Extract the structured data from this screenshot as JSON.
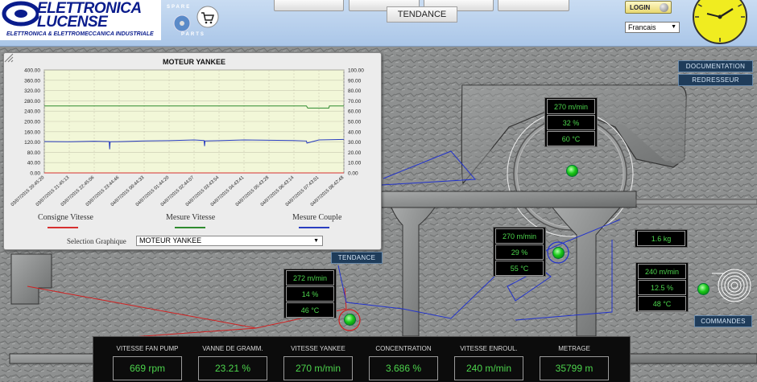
{
  "header": {
    "logo_line1": "ELETTRONICA",
    "logo_line2": "LUCENSE",
    "logo_sub": "ELETTRONICA & ELETTROMECCANICA INDUSTRIALE",
    "spare_text": "SPARE",
    "parts_text": "PARTS",
    "tendance_button": "TENDANCE",
    "login_label": "LOGIN",
    "language": "Francais"
  },
  "chart_window": {
    "selection_label": "Selection Graphique",
    "selection_value": "MOTEUR YANKEE",
    "legend": [
      {
        "label": "Consigne Vitesse",
        "color": "#d63030"
      },
      {
        "label": "Mesure Vitesse",
        "color": "#2e8b2e"
      },
      {
        "label": "Mesure Couple",
        "color": "#2a3ec0"
      }
    ]
  },
  "chart_data": {
    "type": "line",
    "title": "MOTEUR YANKEE",
    "y_left": {
      "ylim": [
        0,
        400
      ],
      "ticks": [
        "400.00",
        "360.00",
        "320.00",
        "280.00",
        "240.00",
        "200.00",
        "160.00",
        "120.00",
        "80.00",
        "40.00",
        "0.00"
      ]
    },
    "y_right": {
      "ylim": [
        0,
        100
      ],
      "ticks": [
        "100.00",
        "90.00",
        "80.00",
        "70.00",
        "60.00",
        "50.00",
        "40.00",
        "30.00",
        "20.00",
        "10.00",
        "0.00"
      ]
    },
    "x_ticks": [
      "03/07/2015 20:45:20",
      "03/07/2015 21:45:13",
      "03/07/2015 22:45:06",
      "03/07/2015 23:44:46",
      "04/07/2015 00:44:33",
      "04/07/2015 01:44:20",
      "04/07/2015 02:44:07",
      "04/07/2015 03:43:54",
      "04/07/2015 04:43:41",
      "04/07/2015 05:43:28",
      "04/07/2015 06:43:14",
      "04/07/2015 07:43:01",
      "04/07/2015 08:42:48"
    ],
    "grid": true,
    "series": [
      {
        "name": "Mesure Vitesse",
        "color": "#2e8b2e",
        "axis": "right",
        "x": [
          0,
          10.5,
          10.55,
          11.4,
          11.42,
          12
        ],
        "y": [
          65,
          65,
          63,
          63,
          65,
          65
        ]
      },
      {
        "name": "Mesure Couple",
        "color": "#2a3ec0",
        "axis": "right",
        "x": [
          0,
          1,
          2,
          2.6,
          2.62,
          2.64,
          3,
          4,
          5,
          6,
          6.4,
          6.42,
          6.44,
          7,
          8,
          9,
          10,
          10.5,
          10.52,
          11,
          12
        ],
        "y": [
          30.5,
          30.2,
          30.8,
          30.5,
          23,
          30.3,
          30.4,
          31,
          31.3,
          32,
          31.5,
          26,
          31,
          31.3,
          32,
          31.7,
          31.5,
          31,
          29,
          32,
          32.5
        ]
      },
      {
        "name": "Consigne Vitesse",
        "color": "#d63030",
        "axis": "right",
        "x": [
          0,
          12
        ],
        "y": [
          0,
          0
        ]
      }
    ]
  },
  "overlays": {
    "tendance_button": "TENDANCE",
    "documentation_button": "DOCUMENTATION",
    "redresseur_button": "REDRESSEUR",
    "commandes_button": "COMMANDES",
    "yankee_readouts": [
      "270 m/min",
      "32 %",
      "60 °C"
    ],
    "middle_readouts": [
      "270 m/min",
      "29 %",
      "55 °C"
    ],
    "left_readouts": [
      "272 m/min",
      "14 %",
      "46 °C"
    ],
    "weight_readout": "1.6 kg",
    "reel_readouts": [
      "240 m/min",
      "12.5 %",
      "48 °C"
    ]
  },
  "bottom_panel": [
    {
      "label": "VITESSE FAN PUMP",
      "value": "669 rpm"
    },
    {
      "label": "VANNE DE GRAMM.",
      "value": "23.21 %"
    },
    {
      "label": "VITESSE YANKEE",
      "value": "270 m/min"
    },
    {
      "label": "CONCENTRATION",
      "value": "3.686 %"
    },
    {
      "label": "VITESSE ENROUL.",
      "value": "240 m/min"
    },
    {
      "label": "METRAGE",
      "value": "35799 m"
    }
  ],
  "colors": {
    "led_green": "#18c818",
    "readout_green": "#4cd44c",
    "header_blue": "#aac6e8"
  }
}
